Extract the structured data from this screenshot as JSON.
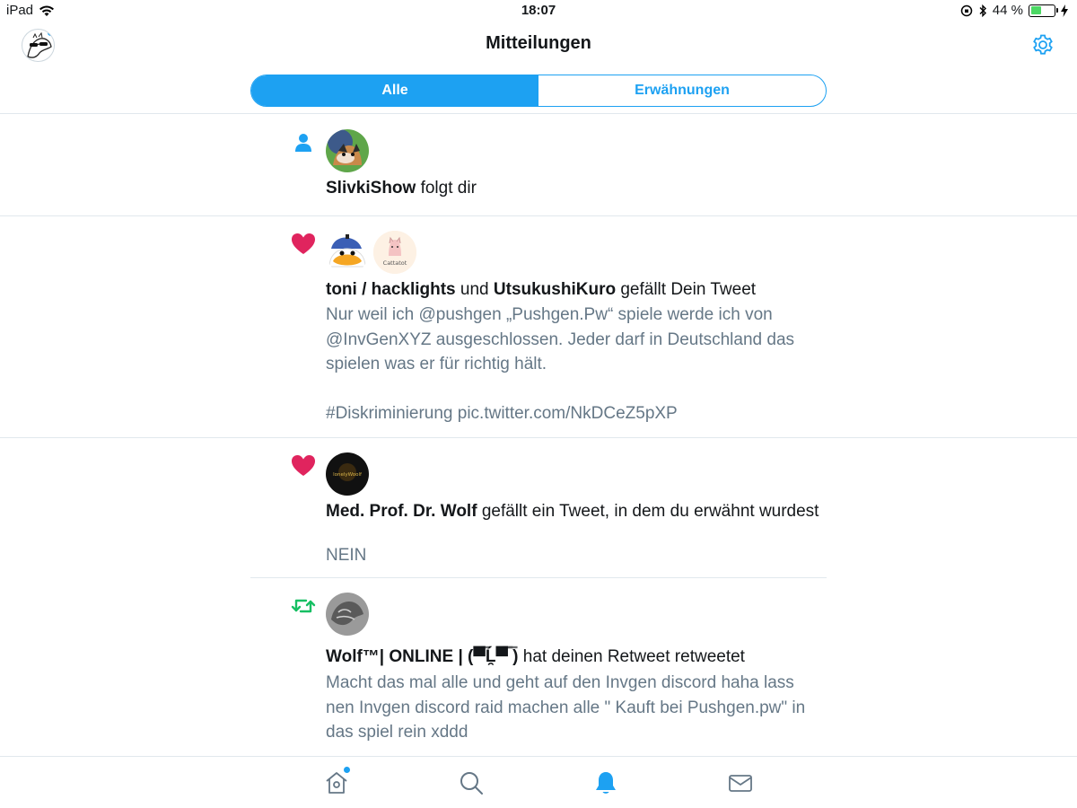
{
  "status_bar": {
    "device": "iPad",
    "time": "18:07",
    "battery_percent": "44 %",
    "battery_level": 0.44
  },
  "nav": {
    "title": "Mitteilungen"
  },
  "segments": {
    "all": "Alle",
    "mentions": "Erwähnungen"
  },
  "notifications": [
    {
      "type": "follow",
      "type_icon": "person-icon",
      "actor1": "SlivkiShow",
      "rest": " folgt dir"
    },
    {
      "type": "like",
      "type_icon": "heart-icon",
      "actor1": "toni / hacklights",
      "connector": " und ",
      "actor2": "UtsukushiKuro",
      "rest": " gefällt Dein Tweet",
      "avatar2_label": "Cattatot",
      "tweet_text": "Nur weil ich @pushgen „Pushgen.Pw“ spiele werde ich von @InvGenXYZ ausgeschlossen. Jeder darf in Deutschland das spielen was er für richtig hält.\n\n#Diskriminierung pic.twitter.com/NkDCeZ5pXP"
    },
    {
      "type": "like",
      "type_icon": "heart-icon",
      "actor1": "Med. Prof. Dr. Wolf",
      "rest": " gefällt ein Tweet, in dem du erwähnt wurdest",
      "avatar_label": "lonelyWoolf",
      "tweet_text": "NEIN"
    },
    {
      "type": "retweet",
      "type_icon": "retweet-icon",
      "actor1": "Wolf™| ONLINE | (▀̿Ĺ̯▀̿ ̿)",
      "rest": " hat deinen Retweet retweetet",
      "tweet_text": "Macht das mal alle und geht auf den Invgen discord haha lass nen Invgen discord raid machen alle \" Kauft bei Pushgen.pw\" in das spiel rein xddd"
    }
  ],
  "tabbar": {
    "home": "home-icon",
    "search": "search-icon",
    "notifications": "bell-icon",
    "messages": "mail-icon"
  },
  "colors": {
    "accent": "#1da1f2",
    "like": "#e0245e",
    "retweet": "#17bf63",
    "secondary_text": "#657786"
  }
}
